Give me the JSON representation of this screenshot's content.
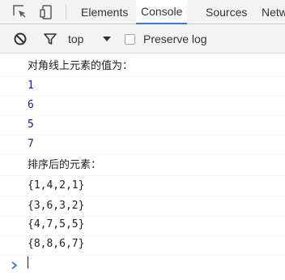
{
  "tabs": {
    "elements": "Elements",
    "console": "Console",
    "sources": "Sources",
    "network": "Netw"
  },
  "toolbar": {
    "context": "top",
    "preserve_log": "Preserve log",
    "preserve_log_checked": false
  },
  "console_lines": [
    {
      "text": "对角线上元素的值为：",
      "kind": "cjk"
    },
    {
      "text": "1",
      "kind": "num"
    },
    {
      "text": "6",
      "kind": "num"
    },
    {
      "text": "5",
      "kind": "num"
    },
    {
      "text": "7",
      "kind": "num"
    },
    {
      "text": "排序后的元素：",
      "kind": "cjk"
    },
    {
      "text": "{1,4,2,1}",
      "kind": "arr"
    },
    {
      "text": "{3,6,3,2}",
      "kind": "arr"
    },
    {
      "text": "{4,7,5,5}",
      "kind": "arr"
    },
    {
      "text": "{8,8,6,7}",
      "kind": "arr"
    }
  ],
  "colors": {
    "number": "#1a1aa6",
    "accent": "#3879d9",
    "prompt": "#3879d9"
  }
}
